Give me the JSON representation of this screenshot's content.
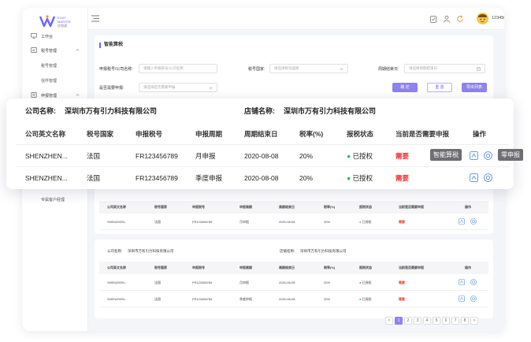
{
  "brand": {
    "line1": "EVAT",
    "line2": "MASTER",
    "line3": "优税通"
  },
  "sidebar": {
    "items": [
      {
        "label": "工作台"
      },
      {
        "label": "税号管理"
      },
      {
        "label": "税号管理"
      },
      {
        "label": "信件管理"
      },
      {
        "label": "申报管理"
      },
      {
        "label": "专属客户经理"
      }
    ]
  },
  "header": {
    "user_name": "1234567891"
  },
  "search": {
    "title": "智能算税",
    "company_label": "申报税号/公司名称:",
    "company_placeholder": "请输入申报税号/公司名称",
    "country_label": "税号国家:",
    "country_placeholder": "请选择税号国家",
    "period_end_label": "周期结束日:",
    "period_end_placeholder": "请选择周期结束日",
    "need_label": "是否需要申报:",
    "need_placeholder": "请选择是否需要申报",
    "confirm": "确 定",
    "reset": "重 置",
    "export": "导出列表"
  },
  "float_card": {
    "company_label": "公司名称:",
    "company_name": "深圳市万有引力科技有限公司",
    "shop_label": "店铺名称:",
    "shop_name": "深圳市万有引力科技有限公司",
    "headers": [
      "公司英文名称",
      "税号国家",
      "申报税号",
      "申报周期",
      "周期结束日",
      "税率(%)",
      "报税状态",
      "当前是否需要申报",
      "操作"
    ],
    "rows": [
      {
        "en_name": "SHENZHEN...",
        "country": "法国",
        "tax_no": "FR123456789",
        "period": "月申报",
        "end": "2020-08-08",
        "rate": "20%",
        "status": "已授权",
        "need": "需要"
      },
      {
        "en_name": "SHENZHEN...",
        "country": "法国",
        "tax_no": "FR123456789",
        "period": "季度申报",
        "end": "2020-08-08",
        "rate": "20%",
        "status": "已授权",
        "need": "需要"
      }
    ]
  },
  "tooltips": {
    "smart_tax": "智能算税",
    "zero_declare": "零申报"
  },
  "card2": {
    "headers": [
      "公司英文名称",
      "税号国家",
      "申报税号",
      "申报周期",
      "周期结束日",
      "税率(%)",
      "报税状态",
      "当前是否需要申报",
      "操作"
    ],
    "rows": [
      {
        "en_name": "SHENZHEN...",
        "country": "法国",
        "tax_no": "FR123456789",
        "period": "月申报",
        "end": "2020-08-08",
        "rate": "20%",
        "status": "已授权",
        "need": "需要"
      }
    ]
  },
  "card3": {
    "company_label": "公司名称:",
    "company_name": "深圳市万有引力科技有限公司",
    "shop_label": "店铺名称:",
    "shop_name": "深圳市万有引力科技有限公司",
    "headers": [
      "公司英文名称",
      "税号国家",
      "申报税号",
      "申报周期",
      "周期结束日",
      "税率(%)",
      "报税状态",
      "当前是否需要申报",
      "操作"
    ],
    "rows": [
      {
        "en_name": "SHENZHEN...",
        "country": "法国",
        "tax_no": "FR123456789",
        "period": "月申报",
        "end": "2020-08-08",
        "rate": "20%",
        "status": "已授权",
        "need": "需要"
      },
      {
        "en_name": "SHENZHEN...",
        "country": "法国",
        "tax_no": "FR123456789",
        "period": "季度申报",
        "end": "2020-08-08",
        "rate": "20%",
        "status": "已授权",
        "need": "需要"
      }
    ]
  },
  "pagination": {
    "prev": "<",
    "pages": [
      "1",
      "2",
      "3",
      "4",
      "5",
      "6",
      "7",
      "8"
    ],
    "next": ">",
    "active": "1"
  },
  "colors": {
    "accent": "#8e82ee",
    "danger": "#ee3333",
    "success": "#2ab566"
  }
}
